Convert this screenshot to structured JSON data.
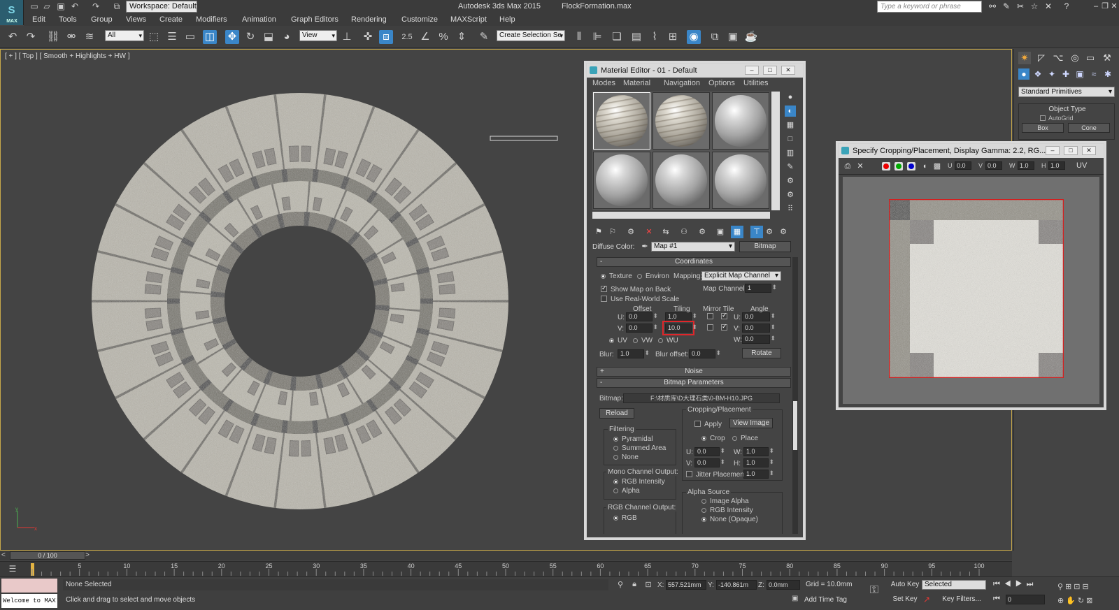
{
  "app": {
    "logo_text": "MAX",
    "workspace": "Workspace: Default",
    "title": "Autodesk 3ds Max  2015",
    "filename": "FlockFormation.max",
    "search_placeholder": "Type a keyword or phrase"
  },
  "menu": [
    "Edit",
    "Tools",
    "Group",
    "Views",
    "Create",
    "Modifiers",
    "Animation",
    "Graph Editors",
    "Rendering",
    "Customize",
    "MAXScript",
    "Help"
  ],
  "toolbar": {
    "selection_filter": "All",
    "reference_coord": "View",
    "snap_label": "2.5",
    "named_selection": "Create Selection Se"
  },
  "viewport": {
    "label": "[ + ] [ Top ] [ Smooth + Highlights + HW ]"
  },
  "command_panel": {
    "category": "Standard Primitives",
    "object_type_title": "Object Type",
    "autogrid": "AutoGrid",
    "btn_box": "Box",
    "btn_cone": "Cone"
  },
  "material_editor": {
    "title": "Material Editor - 01 - Default",
    "menu": [
      "Modes",
      "Material",
      "Navigation",
      "Options",
      "Utilities"
    ],
    "diffuse_label": "Diffuse Color:",
    "map_name": "Map #1",
    "map_type": "Bitmap",
    "coordinates": {
      "title": "Coordinates",
      "texture": "Texture",
      "environ": "Environ",
      "mapping_label": "Mapping:",
      "mapping_value": "Explicit Map Channel",
      "show_map_on_back": "Show Map on Back",
      "map_channel_label": "Map Channel:",
      "map_channel_value": "1",
      "use_real_world": "Use Real-World Scale",
      "col_offset": "Offset",
      "col_tiling": "Tiling",
      "col_mirror_tile": "Mirror Tile",
      "col_angle": "Angle",
      "u_label": "U:",
      "v_label": "V:",
      "w_label": "W:",
      "offset_u": "0.0",
      "offset_v": "0.0",
      "tiling_u": "1.0",
      "tiling_v": "10.0",
      "angle_u": "0.0",
      "angle_v": "0.0",
      "angle_w": "0.0",
      "uv": "UV",
      "vw": "VW",
      "wu": "WU",
      "blur_label": "Blur:",
      "blur_value": "1.0",
      "blur_offset_label": "Blur offset:",
      "blur_offset_value": "0.0",
      "rotate": "Rotate"
    },
    "noise_title": "Noise",
    "bitmap_params": {
      "title": "Bitmap Parameters",
      "bitmap_label": "Bitmap:",
      "bitmap_path": "F:\\材质库\\D大理石类\\0-BM-H10.JPG",
      "reload": "Reload",
      "cropping_title": "Cropping/Placement",
      "apply": "Apply",
      "view_image": "View Image",
      "crop": "Crop",
      "place": "Place",
      "u_label": "U:",
      "v_label": "V:",
      "w_label": "W:",
      "h_label": "H:",
      "crop_u": "0.0",
      "crop_v": "0.0",
      "crop_w": "1.0",
      "crop_h": "1.0",
      "jitter_label": "Jitter Placement:",
      "jitter_value": "1.0",
      "filtering_title": "Filtering",
      "pyramidal": "Pyramidal",
      "summed_area": "Summed Area",
      "none": "None",
      "mono_title": "Mono Channel Output:",
      "rgb_intensity": "RGB Intensity",
      "alpha": "Alpha",
      "rgb_channel_title": "RGB Channel Output:",
      "rgb": "RGB",
      "alpha_source_title": "Alpha Source",
      "image_alpha": "Image Alpha",
      "as_rgb_intensity": "RGB Intensity",
      "none_opaque": "None (Opaque)"
    }
  },
  "crop_dialog": {
    "title": "Specify Cropping/Placement, Display Gamma: 2.2, RG...",
    "u_label": "U",
    "u_value": "0.0",
    "v_label": "V",
    "v_value": "0.0",
    "w_label": "W",
    "w_value": "1.0",
    "h_label": "H",
    "h_value": "1.0",
    "uv_label": "UV"
  },
  "timeline": {
    "frame_range": "0 / 100",
    "ticks": [
      "5",
      "10",
      "15",
      "20",
      "25",
      "30",
      "35",
      "40",
      "45",
      "50",
      "55",
      "60",
      "65",
      "70",
      "75",
      "80",
      "85",
      "90",
      "95",
      "100"
    ]
  },
  "status": {
    "maxscript_listener": "Welcome to MAX!",
    "selection": "None Selected",
    "prompt": "Click and drag to select and move objects",
    "x_label": "X:",
    "x_value": "557.521mm",
    "y_label": "Y:",
    "y_value": "-140.861m",
    "z_label": "Z:",
    "z_value": "0.0mm",
    "grid": "Grid = 10.0mm",
    "add_time_tag": "Add Time Tag",
    "auto_key": "Auto Key",
    "set_key": "Set Key",
    "key_mode": "Selected",
    "key_filters": "Key Filters...",
    "current_frame": "0"
  },
  "colors": {
    "accent_blue": "#3a86c8",
    "highlight_red": "#e0262a",
    "viewport_bg": "#444444"
  }
}
